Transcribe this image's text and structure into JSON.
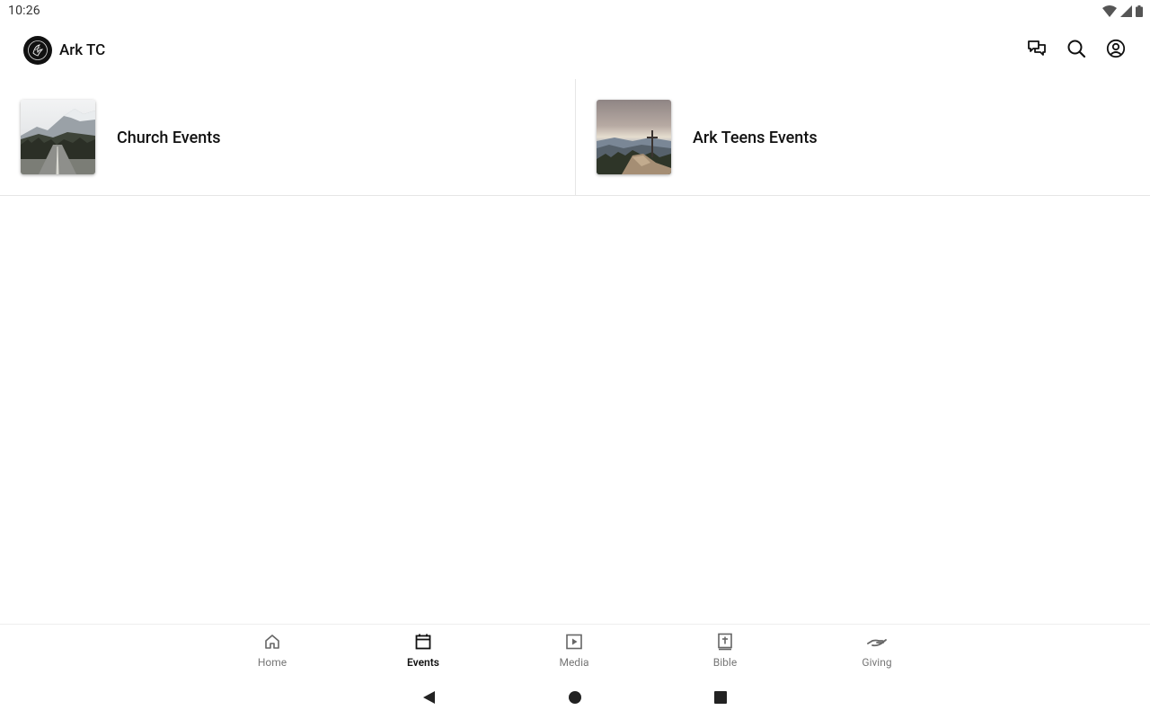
{
  "status_bar": {
    "time": "10:26"
  },
  "app_bar": {
    "title": "Ark TC",
    "actions": [
      "chat-icon",
      "search-icon",
      "account-icon"
    ]
  },
  "events": [
    {
      "label": "Church Events",
      "thumbnail": "mountain-road-image"
    },
    {
      "label": "Ark Teens Events",
      "thumbnail": "mountain-cross-image"
    }
  ],
  "bottom_nav": {
    "items": [
      {
        "label": "Home",
        "icon": "home-icon"
      },
      {
        "label": "Events",
        "icon": "calendar-icon",
        "active": true
      },
      {
        "label": "Media",
        "icon": "play-icon"
      },
      {
        "label": "Bible",
        "icon": "bible-icon"
      },
      {
        "label": "Giving",
        "icon": "giving-hand-icon"
      }
    ]
  },
  "colors": {
    "text": "#111111",
    "muted": "#777777",
    "divider": "#e6e6e6",
    "logo_bg": "#111111"
  }
}
